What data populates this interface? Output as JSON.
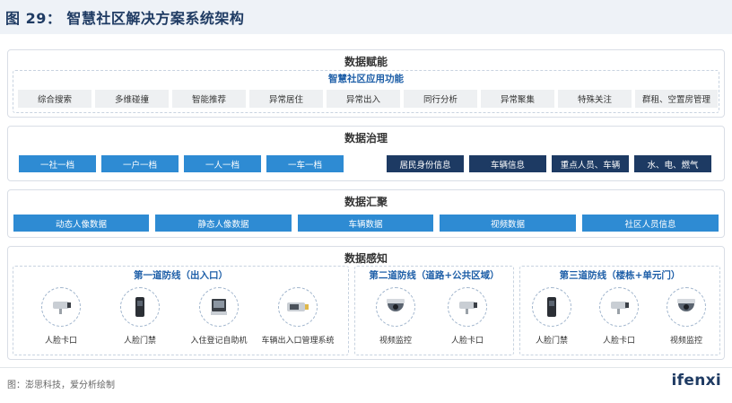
{
  "header": {
    "title": "图 29：  智慧社区解决方案系统架构"
  },
  "layer_empower": {
    "title": "数据赋能",
    "subtitle": "智慧社区应用功能",
    "items": [
      "综合搜索",
      "多维碰撞",
      "智能推荐",
      "异常居住",
      "异常出入",
      "同行分析",
      "异常聚集",
      "特殊关注",
      "群租、空置房管理"
    ]
  },
  "layer_governance": {
    "title": "数据治理",
    "left_items": [
      "一社一档",
      "一户一档",
      "一人一档",
      "一车一档"
    ],
    "right_items": [
      "居民身份信息",
      "车辆信息",
      "重点人员、车辆",
      "水、电、燃气"
    ]
  },
  "layer_aggregation": {
    "title": "数据汇聚",
    "items": [
      "动态人像数据",
      "静态人像数据",
      "车辆数据",
      "视频数据",
      "社区人员信息"
    ]
  },
  "layer_perception": {
    "title": "数据感知",
    "groups": [
      {
        "title": "第一道防线（出入口）",
        "devices": [
          {
            "label": "人脸卡口",
            "icon": "face-camera-icon"
          },
          {
            "label": "人脸门禁",
            "icon": "face-access-terminal-icon"
          },
          {
            "label": "入住登记自助机",
            "icon": "self-service-kiosk-icon"
          },
          {
            "label": "车辆出入口管理系统",
            "icon": "vehicle-gate-camera-icon"
          }
        ]
      },
      {
        "title": "第二道防线（道路+公共区域）",
        "devices": [
          {
            "label": "视频监控",
            "icon": "dome-camera-icon"
          },
          {
            "label": "人脸卡口",
            "icon": "face-camera-icon"
          }
        ]
      },
      {
        "title": "第三道防线（楼栋+单元门）",
        "devices": [
          {
            "label": "人脸门禁",
            "icon": "face-access-terminal-icon"
          },
          {
            "label": "人脸卡口",
            "icon": "face-camera-icon"
          },
          {
            "label": "视频监控",
            "icon": "dome-camera-icon"
          }
        ]
      }
    ]
  },
  "footer": {
    "source": "图：澎思科技，爱分析绘制",
    "logo": "ifenxi"
  },
  "colors": {
    "blue_box": "#2e8bd3",
    "navy_box": "#1d3a63",
    "title_blue": "#1e5fa8",
    "grey_box": "#eef0f2"
  }
}
